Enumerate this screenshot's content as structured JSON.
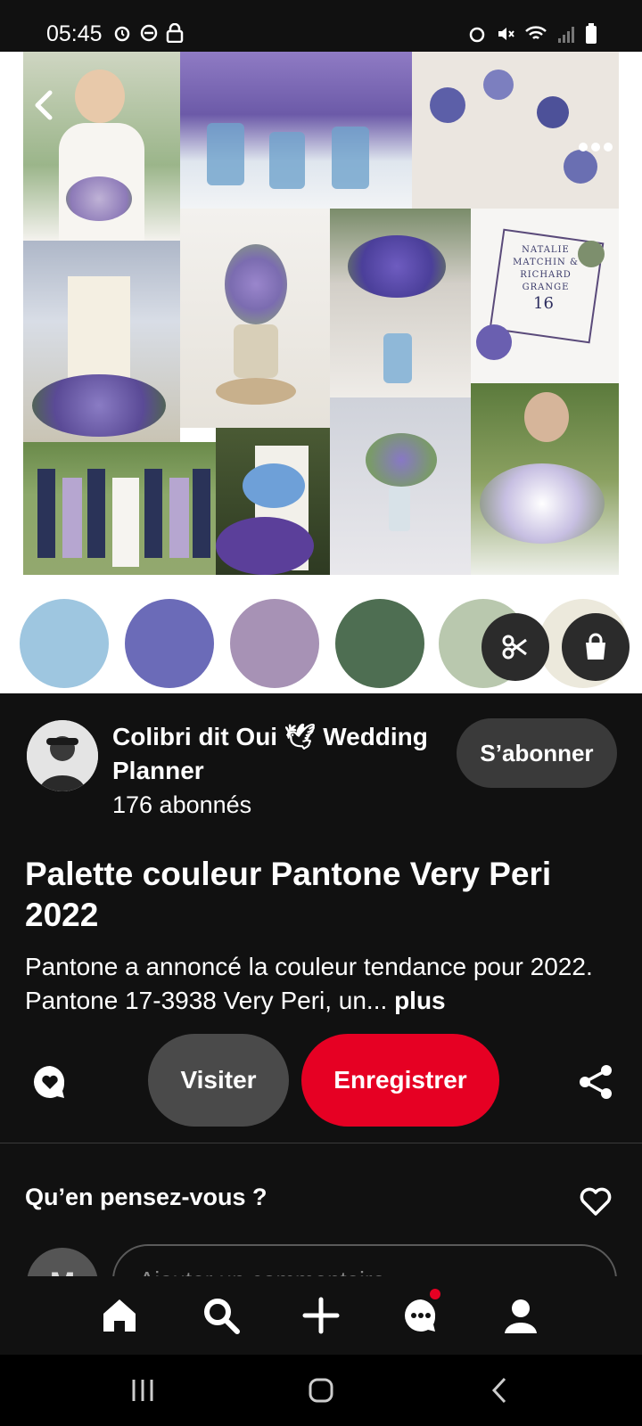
{
  "status_bar": {
    "time": "05:45"
  },
  "colors": {
    "brand_red": "#e60023",
    "background": "#111111",
    "palette": [
      "#9ec6e0",
      "#6b6bb8",
      "#a792b5",
      "#4e6e52",
      "#b9c8ae",
      "#ece9dc"
    ]
  },
  "pin": {
    "creator_name": "Colibri dit Oui 🕊 Wedding Planner",
    "followers": "176 abonnés",
    "follow_label": "S’abonner",
    "title": "Palette couleur Pantone Very Peri 2022",
    "description": "Pantone a annoncé la couleur tendance pour 2022. Pantone 17-3938 Very Peri, un...",
    "more_label": "plus",
    "invitation": {
      "names": "NATALIE MATCHIN & RICHARD GRANGE",
      "date_number": "16"
    }
  },
  "actions": {
    "visit_label": "Visiter",
    "save_label": "Enregistrer"
  },
  "comments": {
    "heading": "Qu’en pensez-vous ?",
    "user_initial": "M",
    "placeholder": "Ajouter un commentaire"
  },
  "icons": {
    "back": "chevron-left-icon",
    "more": "more-icon",
    "scissors": "scissors-icon",
    "shopping": "shopping-bag-icon",
    "comment": "comment-icon",
    "share": "share-icon",
    "heart": "heart-icon",
    "nav": [
      "home-icon",
      "search-icon",
      "plus-icon",
      "chat-icon",
      "profile-icon"
    ]
  }
}
